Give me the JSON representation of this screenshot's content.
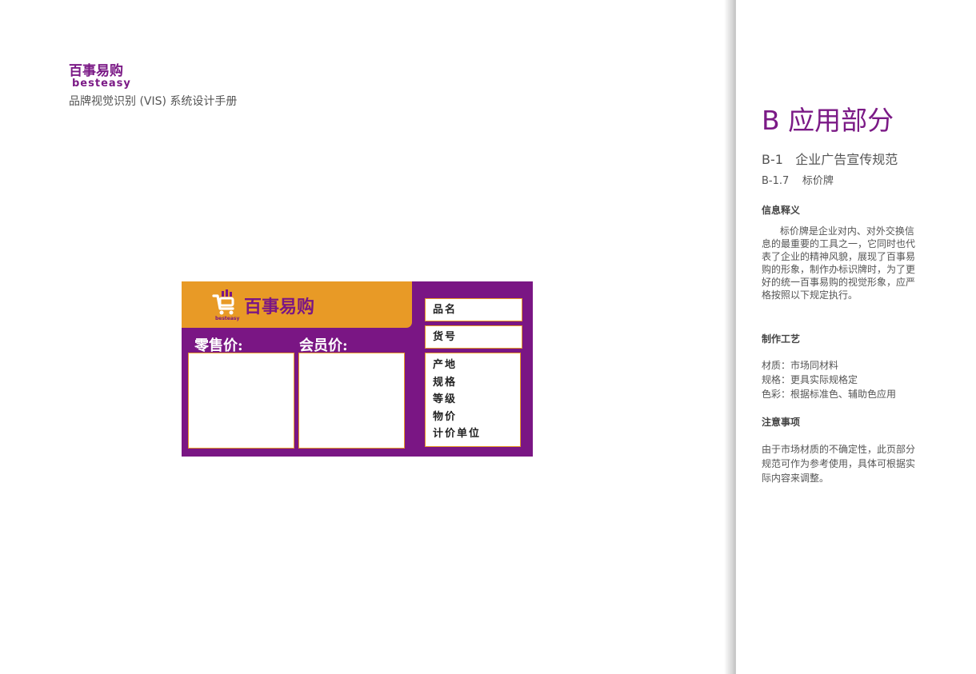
{
  "header": {
    "brand_cn": "百事易购",
    "brand_en": "besteasy",
    "subtitle": "品牌视觉识别 (VIS) 系统设计手册"
  },
  "price_tag": {
    "banner_logo_cn": "百事易购",
    "banner_logo_en": "besteasy",
    "retail_price_label": "零售价:",
    "member_price_label": "会员价:",
    "fields": {
      "product_name": "品名",
      "item_no": "货号",
      "origin": "产地",
      "spec": "规格",
      "grade": "等级",
      "price_checker": "物价",
      "unit": "计价单位"
    },
    "colors": {
      "purple": "#7a1684",
      "orange": "#e89a26"
    }
  },
  "panel": {
    "title": "B 应用部分",
    "section": "B-1   企业广告宣传规范",
    "subsection": "B-1.7    标价牌",
    "definition_heading": "信息释义",
    "definition_lines": [
      "      标价牌是企业对内、对外交换信",
      "息的最重要的工具之一，它同时也代",
      "表了企业的精神风貌，展现了百事易",
      "购的形象，制作办标识牌时，为了更",
      "好的统一百事易购的视觉形象，应严",
      "格按照以下规定执行。"
    ],
    "craft_heading": "制作工艺",
    "material": "材质：市场同材料",
    "spec": "规格：更具实际规格定",
    "color": "色彩：根据标准色、辅助色应用",
    "notice_heading": "注意事项",
    "notice_lines": [
      "由于市场材质的不确定性，此页部分",
      "规范可作为参考使用，具体可根据实",
      "际内容来调整。"
    ]
  }
}
